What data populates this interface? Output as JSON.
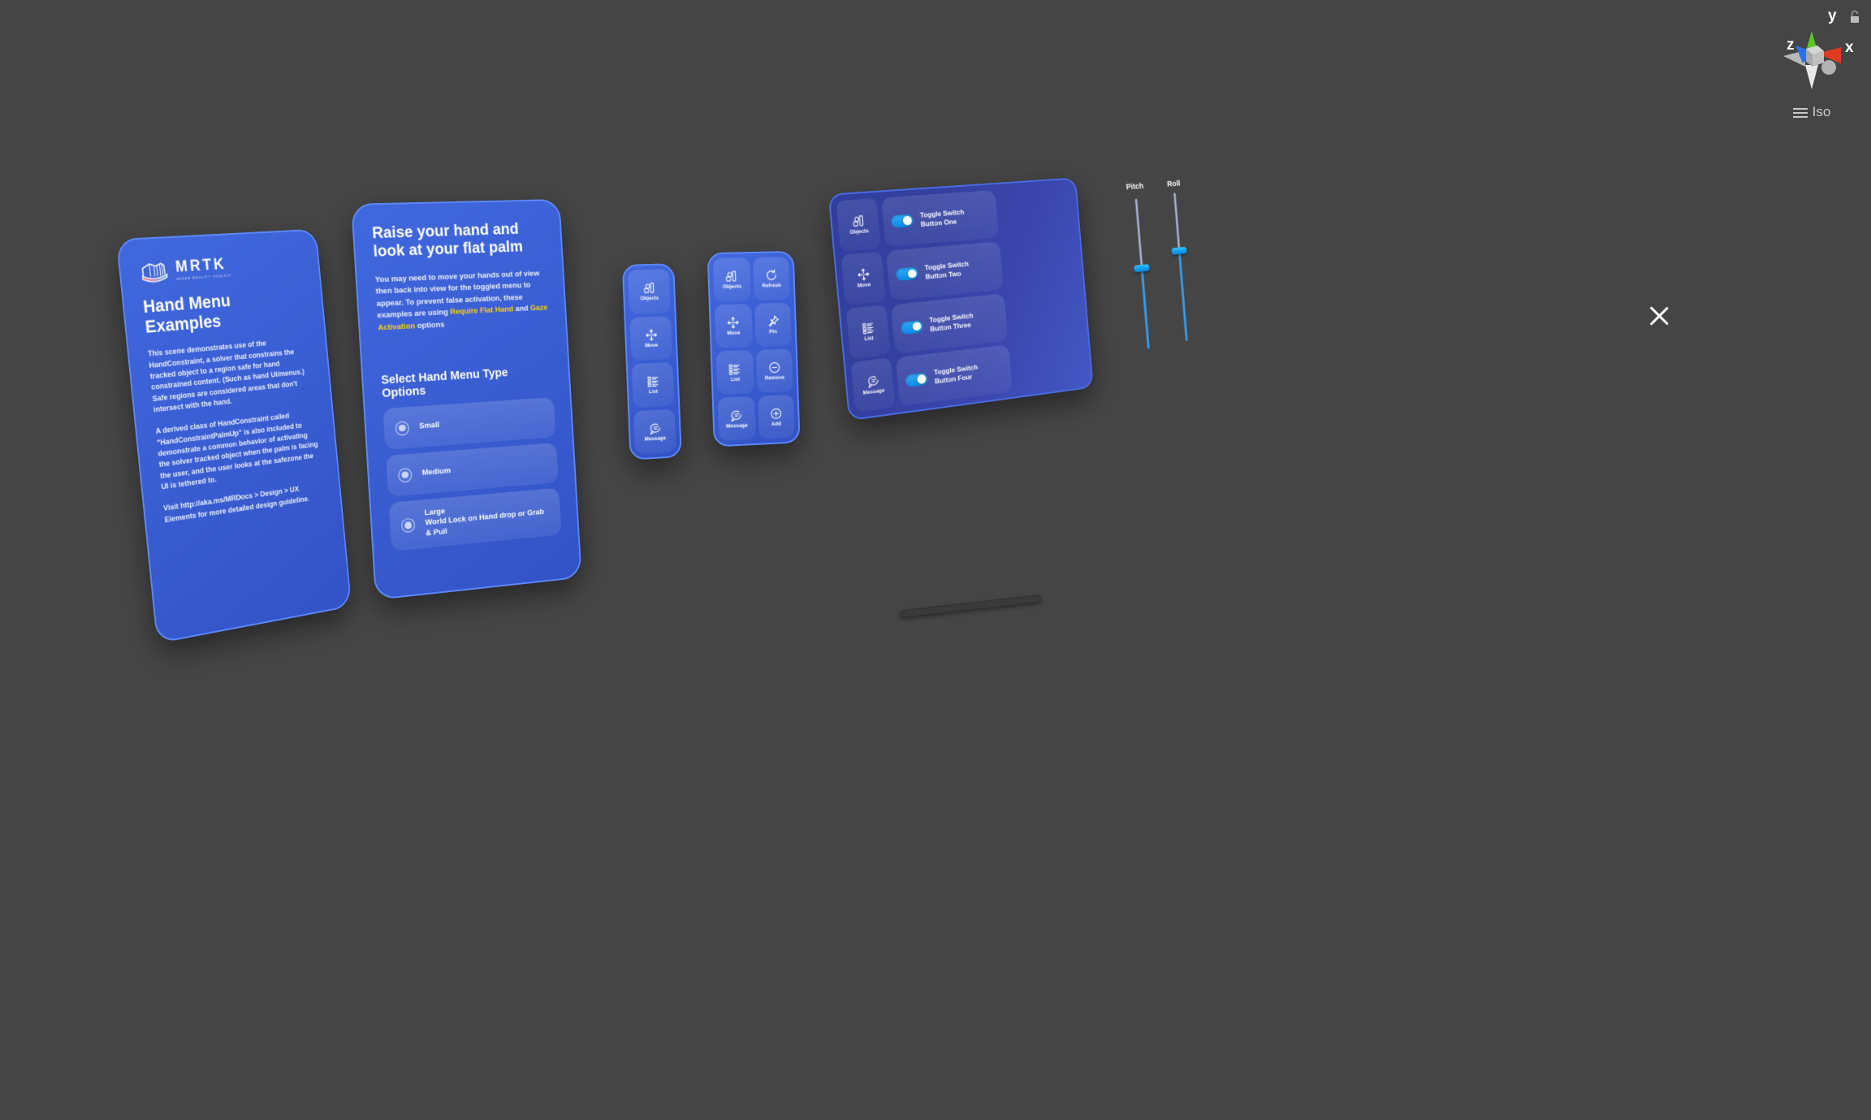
{
  "scene": {
    "background_color": "#454545",
    "gizmo": {
      "label": "Iso",
      "axis_x": "x",
      "axis_y": "y",
      "axis_z": "z",
      "lock_icon": "padlock-icon"
    },
    "close_button_label": "close-icon"
  },
  "info_panel": {
    "logo": {
      "wordmark": "MRTK",
      "tagline": "MIXED REALITY TOOLKIT"
    },
    "title": "Hand Menu Examples",
    "paragraphs": [
      "This scene demonstrates use of the HandConstraint, a solver that constrains the tracked object to a region safe for hand constrained content. (Such as hand UI/menus.) Safe regions are considered areas that don't intersect with the hand.",
      "A derived class of HandConstraint called \"HandConstraintPalmUp\" is also included to demonstrate a common behavior of activating the solver tracked object when the palm is facing the user, and the user looks at the safezone the UI is tethered to.",
      "Visit http://aka.ms/MRDocs > Design > UX Elements for more detailed design guideline."
    ]
  },
  "raise_panel": {
    "title": "Raise your hand and look at your flat palm",
    "body_part1": "You may need to move your hands out of view then back into view for the toggled menu to appear. To prevent false activation, these examples are using ",
    "body_highlight1": "Require Flat Hand",
    "body_part2": " and ",
    "body_highlight2": "Gaze Activation",
    "body_part3": " options",
    "section_heading": "Select Hand Menu Type Options",
    "options": [
      {
        "label": "Small",
        "sub": "",
        "selected": true
      },
      {
        "label": "Medium",
        "sub": "",
        "selected": true
      },
      {
        "label": "Large",
        "sub": "World Lock on Hand drop or Grab & Pull",
        "selected": true
      }
    ]
  },
  "slim_menu": {
    "items": [
      {
        "label": "Objects",
        "icon": "objects-icon"
      },
      {
        "label": "Move",
        "icon": "move-icon"
      },
      {
        "label": "List",
        "icon": "list-icon"
      },
      {
        "label": "Message",
        "icon": "message-icon"
      }
    ]
  },
  "grid_menu": {
    "items": [
      {
        "label": "Objects",
        "icon": "objects-icon"
      },
      {
        "label": "Refresh",
        "icon": "refresh-icon"
      },
      {
        "label": "Move",
        "icon": "move-icon"
      },
      {
        "label": "Pin",
        "icon": "pin-icon"
      },
      {
        "label": "List",
        "icon": "list-icon"
      },
      {
        "label": "Remove",
        "icon": "remove-icon"
      },
      {
        "label": "Message",
        "icon": "message-icon"
      },
      {
        "label": "Add",
        "icon": "add-icon"
      }
    ]
  },
  "toggle_panel": {
    "icon_rail": [
      {
        "label": "Objects",
        "icon": "objects-icon"
      },
      {
        "label": "Move",
        "icon": "move-icon"
      },
      {
        "label": "List",
        "icon": "list-icon"
      },
      {
        "label": "Message",
        "icon": "message-icon"
      }
    ],
    "toggles": [
      {
        "line1": "Toggle Switch",
        "line2": "Button One",
        "on": true
      },
      {
        "line1": "Toggle Switch",
        "line2": "Button Two",
        "on": true
      },
      {
        "line1": "Toggle Switch",
        "line2": "Button Three",
        "on": true
      },
      {
        "line1": "Toggle Switch",
        "line2": "Button Four",
        "on": true
      }
    ],
    "sliders": [
      {
        "label": "Pitch",
        "value_percent": 46
      },
      {
        "label": "Roll",
        "value_percent": 52
      }
    ],
    "accent_color": "#18a0f0",
    "panel_color": "#36409f"
  }
}
